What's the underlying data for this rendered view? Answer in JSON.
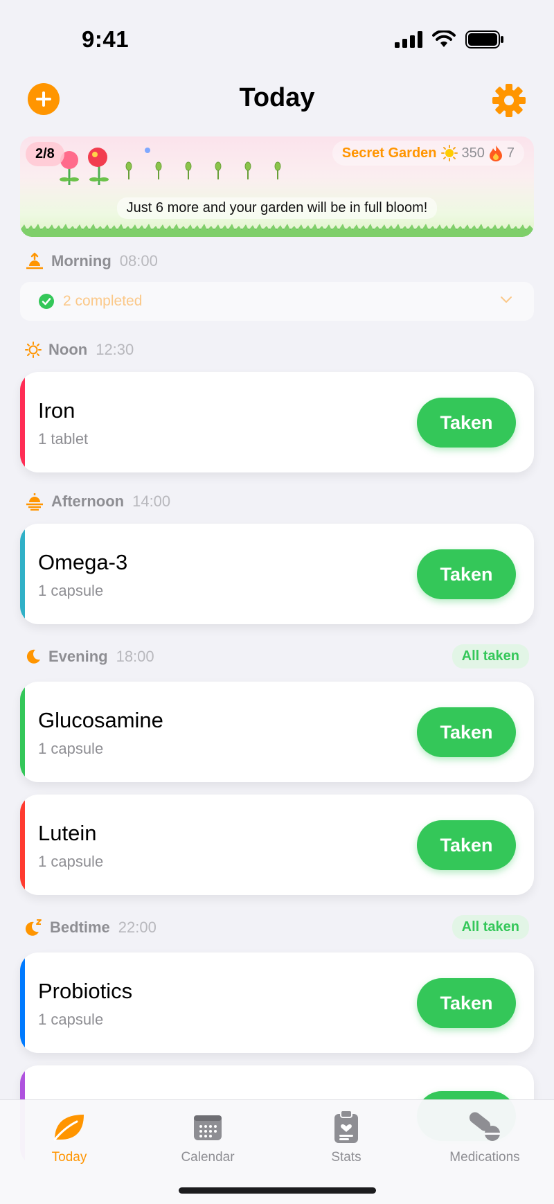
{
  "status_bar": {
    "time": "9:41"
  },
  "nav": {
    "title": "Today",
    "add_icon": "plus-icon",
    "settings_icon": "gear-icon"
  },
  "garden": {
    "progress_label": "2/8",
    "name": "Secret Garden",
    "sun_count": "350",
    "streak_count": "7",
    "message": "Just 6 more and your garden will be in full bloom!"
  },
  "sections": {
    "morning": {
      "name": "Morning",
      "time": "08:00",
      "completed_label": "2 completed"
    },
    "noon": {
      "name": "Noon",
      "time": "12:30"
    },
    "afternoon": {
      "name": "Afternoon",
      "time": "14:00"
    },
    "evening": {
      "name": "Evening",
      "time": "18:00",
      "badge": "All taken"
    },
    "bedtime": {
      "name": "Bedtime",
      "time": "22:00",
      "badge": "All taken"
    }
  },
  "medications": [
    {
      "name": "Iron",
      "dose": "1 tablet",
      "button": "Taken",
      "color": "#ff2d55"
    },
    {
      "name": "Omega-3",
      "dose": "1 capsule",
      "button": "Taken",
      "color": "#30b0c7"
    },
    {
      "name": "Glucosamine",
      "dose": "1 capsule",
      "button": "Taken",
      "color": "#34c759"
    },
    {
      "name": "Lutein",
      "dose": "1 capsule",
      "button": "Taken",
      "color": "#ff3b30"
    },
    {
      "name": "Probiotics",
      "dose": "1 capsule",
      "button": "Taken",
      "color": "#007aff"
    },
    {
      "name": "",
      "dose": "",
      "button": "",
      "color": "#af52de"
    }
  ],
  "tabs": [
    {
      "label": "Today",
      "icon": "leaf-icon",
      "active": true
    },
    {
      "label": "Calendar",
      "icon": "calendar-icon",
      "active": false
    },
    {
      "label": "Stats",
      "icon": "clipboard-icon",
      "active": false
    },
    {
      "label": "Medications",
      "icon": "pills-icon",
      "active": false
    }
  ],
  "colors": {
    "accent": "#ff9500",
    "success": "#34c759",
    "background": "#f2f2f7"
  }
}
